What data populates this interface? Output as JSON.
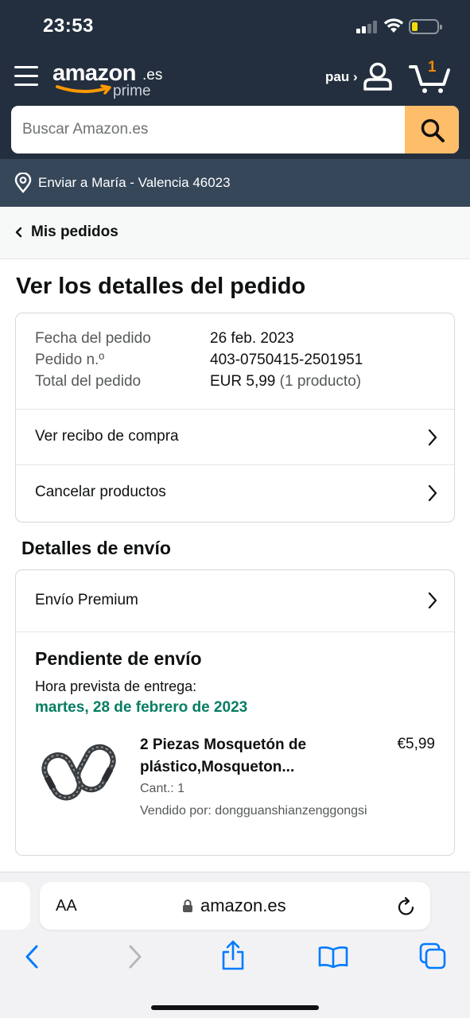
{
  "status_bar": {
    "time": "23:53"
  },
  "header": {
    "logo_word": "amazon",
    "logo_tld": ".es",
    "logo_sub": "prime",
    "account_label": "pau ›",
    "cart_count": "1"
  },
  "search": {
    "placeholder": "Buscar Amazon.es"
  },
  "delivery": {
    "text": "Enviar a María - Valencia 46023"
  },
  "breadcrumb": {
    "label": "Mis pedidos"
  },
  "page": {
    "title": "Ver los detalles del pedido"
  },
  "order_summary": {
    "rows": [
      {
        "label": "Fecha del pedido",
        "value": "26 feb. 2023",
        "extra": ""
      },
      {
        "label": "Pedido n.º",
        "value": "403-0750415-2501951",
        "extra": ""
      },
      {
        "label": "Total del pedido",
        "value": "EUR 5,99",
        "extra": " (1 producto)"
      }
    ],
    "links": [
      "Ver recibo de compra",
      "Cancelar productos"
    ]
  },
  "shipping": {
    "heading": "Detalles de envío",
    "method": "Envío Premium",
    "status_title": "Pendiente de envío",
    "eta_label": "Hora prevista de entrega:",
    "eta_date": "martes, 28 de febrero de 2023",
    "product": {
      "title_line1": "2 Piezas Mosquetón de",
      "title_line2": "plástico,Mosqueton...",
      "price": "€5,99",
      "qty": "Cant.: 1",
      "seller": "Vendido por: dongguanshianzenggongsi"
    }
  },
  "browser": {
    "aa_label": "AA",
    "url": "amazon.es"
  },
  "colors": {
    "header_bg": "#232f3e",
    "deliver_bg": "#37475a",
    "search_button": "#febd69",
    "cart_count": "#f08804",
    "eta_green": "#067d62",
    "ios_blue": "#007aff"
  }
}
